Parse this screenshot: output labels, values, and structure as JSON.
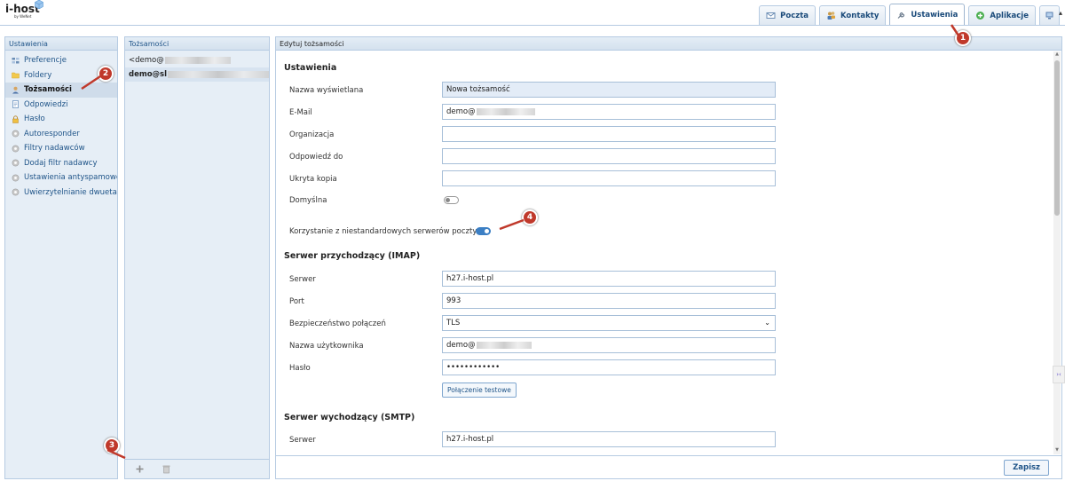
{
  "app": {
    "logo": "i-host",
    "logo_sub": "by WeNet"
  },
  "tabs": [
    {
      "label": "Poczta",
      "icon": "mail-icon"
    },
    {
      "label": "Kontakty",
      "icon": "contacts-icon"
    },
    {
      "label": "Ustawienia",
      "icon": "wrench-icon",
      "active": true
    },
    {
      "label": "Aplikacje",
      "icon": "apps-plus-icon"
    },
    {
      "label": "",
      "icon": "monitor-icon"
    }
  ],
  "settings_panel": {
    "title": "Ustawienia",
    "items": [
      {
        "label": "Preferencje",
        "icon": "preferences-icon"
      },
      {
        "label": "Foldery",
        "icon": "folder-icon"
      },
      {
        "label": "Tożsamości",
        "icon": "person-icon",
        "selected": true
      },
      {
        "label": "Odpowiedzi",
        "icon": "document-icon"
      },
      {
        "label": "Hasło",
        "icon": "lock-icon"
      },
      {
        "label": "Autoresponder",
        "icon": "gear-icon"
      },
      {
        "label": "Filtry nadawców",
        "icon": "gear-icon"
      },
      {
        "label": "Dodaj filtr nadawcy",
        "icon": "gear-icon"
      },
      {
        "label": "Ustawienia antyspamowe",
        "icon": "gear-icon"
      },
      {
        "label": "Uwierzytelnianie dwuetapo",
        "icon": "gear-icon"
      }
    ]
  },
  "identities_panel": {
    "title": "Tożsamości",
    "items": [
      {
        "label": "<demo@"
      },
      {
        "label": "demo@sl",
        "selected": true
      }
    ]
  },
  "edit_panel": {
    "title": "Edytuj tożsamości",
    "section_settings": "Ustawienia",
    "display_name_label": "Nazwa wyświetlana",
    "display_name_value": "Nowa tożsamość",
    "email_label": "E-Mail",
    "email_value": "demo@",
    "organization_label": "Organizacja",
    "reply_to_label": "Odpowiedź do",
    "bcc_label": "Ukryta kopia",
    "default_label": "Domyślna",
    "default_on": false,
    "custom_servers_label": "Korzystanie z niestandardowych serwerów poczty",
    "custom_servers_on": true,
    "section_imap": "Serwer przychodzący (IMAP)",
    "imap_server_label": "Serwer",
    "imap_server_value": "h27.i-host.pl",
    "imap_port_label": "Port",
    "imap_port_value": "993",
    "imap_security_label": "Bezpieczeństwo połączeń",
    "imap_security_value": "TLS",
    "imap_user_label": "Nazwa użytkownika",
    "imap_user_value": "demo@",
    "imap_password_label": "Hasło",
    "imap_password_value": "••••••••••••",
    "test_button": "Połączenie testowe",
    "section_smtp": "Serwer wychodzący (SMTP)",
    "smtp_server_label": "Serwer",
    "smtp_server_value": "h27.i-host.pl",
    "save_button": "Zapisz"
  },
  "annotations": [
    "1",
    "2",
    "3",
    "4"
  ],
  "colors": {
    "badge": "#c0392b",
    "accent": "#1f5488",
    "toggle_on": "#3c7fc4"
  }
}
